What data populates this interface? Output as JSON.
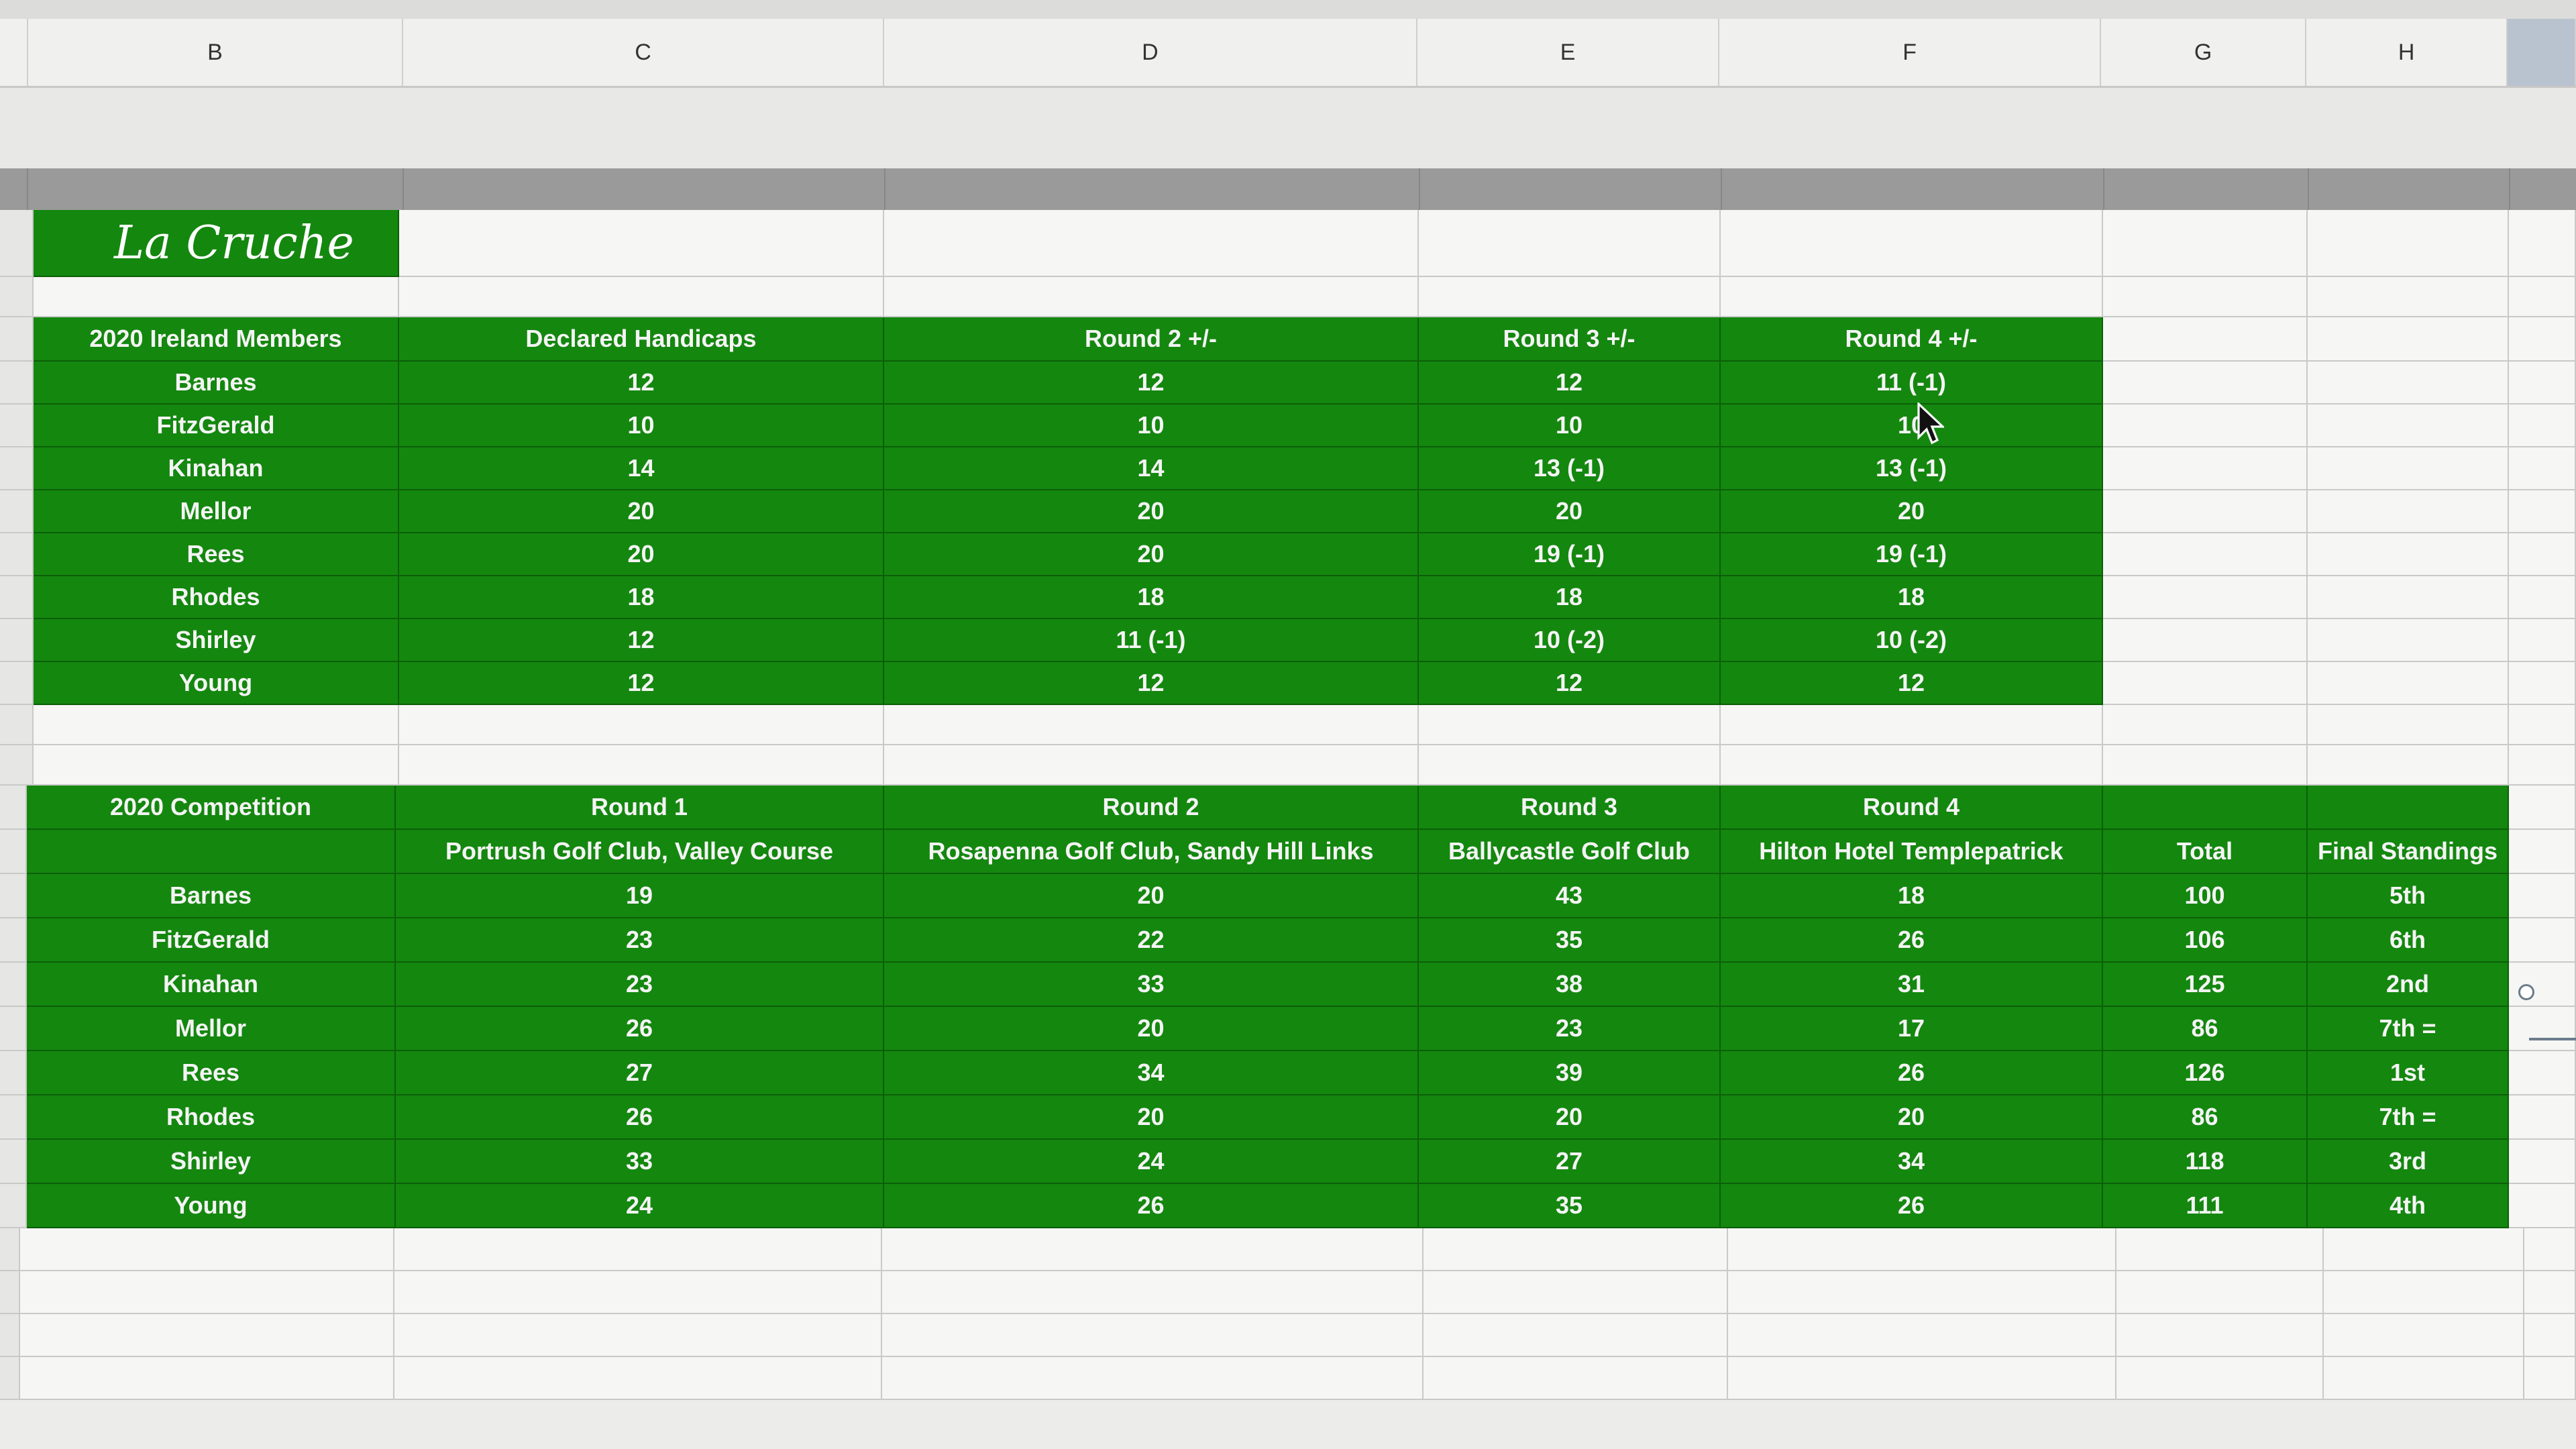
{
  "columns": [
    "B",
    "C",
    "D",
    "E",
    "F",
    "G",
    "H"
  ],
  "title": "La Cruche",
  "handicaps": {
    "headers": [
      "2020 Ireland Members",
      "Declared Handicaps",
      "Round 2 +/-",
      "Round 3 +/-",
      "Round 4 +/-"
    ],
    "rows": [
      [
        "Barnes",
        "12",
        "12",
        "12",
        "11 (-1)"
      ],
      [
        "FitzGerald",
        "10",
        "10",
        "10",
        "10"
      ],
      [
        "Kinahan",
        "14",
        "14",
        "13 (-1)",
        "13 (-1)"
      ],
      [
        "Mellor",
        "20",
        "20",
        "20",
        "20"
      ],
      [
        "Rees",
        "20",
        "20",
        "19 (-1)",
        "19 (-1)"
      ],
      [
        "Rhodes",
        "18",
        "18",
        "18",
        "18"
      ],
      [
        "Shirley",
        "12",
        "11 (-1)",
        "10 (-2)",
        "10 (-2)"
      ],
      [
        "Young",
        "12",
        "12",
        "12",
        "12"
      ]
    ]
  },
  "competition": {
    "header1": [
      "2020 Competition",
      "Round 1",
      "Round 2",
      "Round 3",
      "Round 4",
      "",
      ""
    ],
    "header2": [
      "",
      "Portrush Golf Club, Valley Course",
      "Rosapenna Golf Club, Sandy Hill Links",
      "Ballycastle Golf Club",
      "Hilton Hotel Templepatrick",
      "Total",
      "Final Standings"
    ],
    "rows": [
      [
        "Barnes",
        "19",
        "20",
        "43",
        "18",
        "100",
        "5th"
      ],
      [
        "FitzGerald",
        "23",
        "22",
        "35",
        "26",
        "106",
        "6th"
      ],
      [
        "Kinahan",
        "23",
        "33",
        "38",
        "31",
        "125",
        "2nd"
      ],
      [
        "Mellor",
        "26",
        "20",
        "23",
        "17",
        "86",
        "7th ="
      ],
      [
        "Rees",
        "27",
        "34",
        "39",
        "26",
        "126",
        "1st"
      ],
      [
        "Rhodes",
        "26",
        "20",
        "20",
        "20",
        "86",
        "7th ="
      ],
      [
        "Shirley",
        "33",
        "24",
        "27",
        "34",
        "118",
        "3rd"
      ],
      [
        "Young",
        "24",
        "26",
        "35",
        "26",
        "111",
        "4th"
      ]
    ]
  }
}
